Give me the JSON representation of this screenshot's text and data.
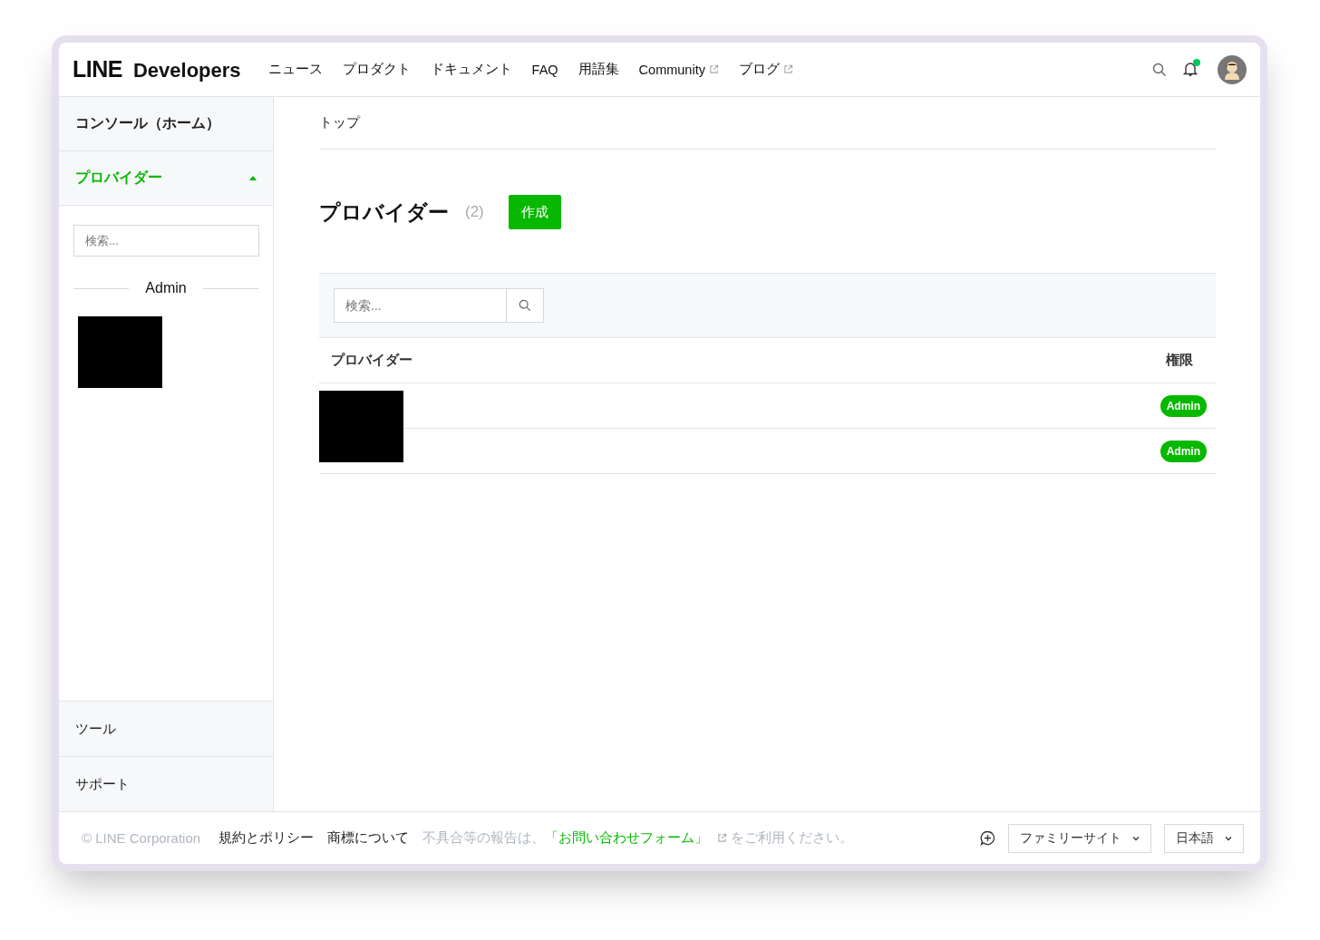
{
  "header": {
    "logo_bold": "LINE",
    "logo_text": "Developers",
    "nav": [
      {
        "label": "ニュース",
        "external": false
      },
      {
        "label": "プロダクト",
        "external": false
      },
      {
        "label": "ドキュメント",
        "external": false
      },
      {
        "label": "FAQ",
        "external": false
      },
      {
        "label": "用語集",
        "external": false
      },
      {
        "label": "Community",
        "external": true
      },
      {
        "label": "ブログ",
        "external": true
      }
    ],
    "notification_unread": true
  },
  "sidebar": {
    "items": [
      {
        "label": "コンソール（ホーム）",
        "selected": false,
        "expanded": false
      },
      {
        "label": "プロバイダー",
        "selected": true,
        "expanded": true
      }
    ],
    "search": {
      "placeholder": "検索..."
    },
    "group_label": "Admin",
    "bottom_items": [
      {
        "label": "ツール"
      },
      {
        "label": "サポート"
      }
    ]
  },
  "breadcrumb": "トップ",
  "page": {
    "title": "プロバイダー",
    "count": "(2)",
    "create_button": "作成"
  },
  "search": {
    "placeholder": "検索..."
  },
  "table": {
    "columns": [
      "プロバイダー",
      "権限"
    ],
    "rows": [
      {
        "role": "Admin"
      },
      {
        "role": "Admin"
      }
    ]
  },
  "footer": {
    "copyright": "© LINE Corporation",
    "links": [
      "規約とポリシー",
      "商標について"
    ],
    "report_prefix": "不具合等の報告は、",
    "report_link": "「お問い合わせフォーム」",
    "report_suffix": "をご利用ください。",
    "family_select": "ファミリーサイト",
    "language_select": "日本語"
  }
}
